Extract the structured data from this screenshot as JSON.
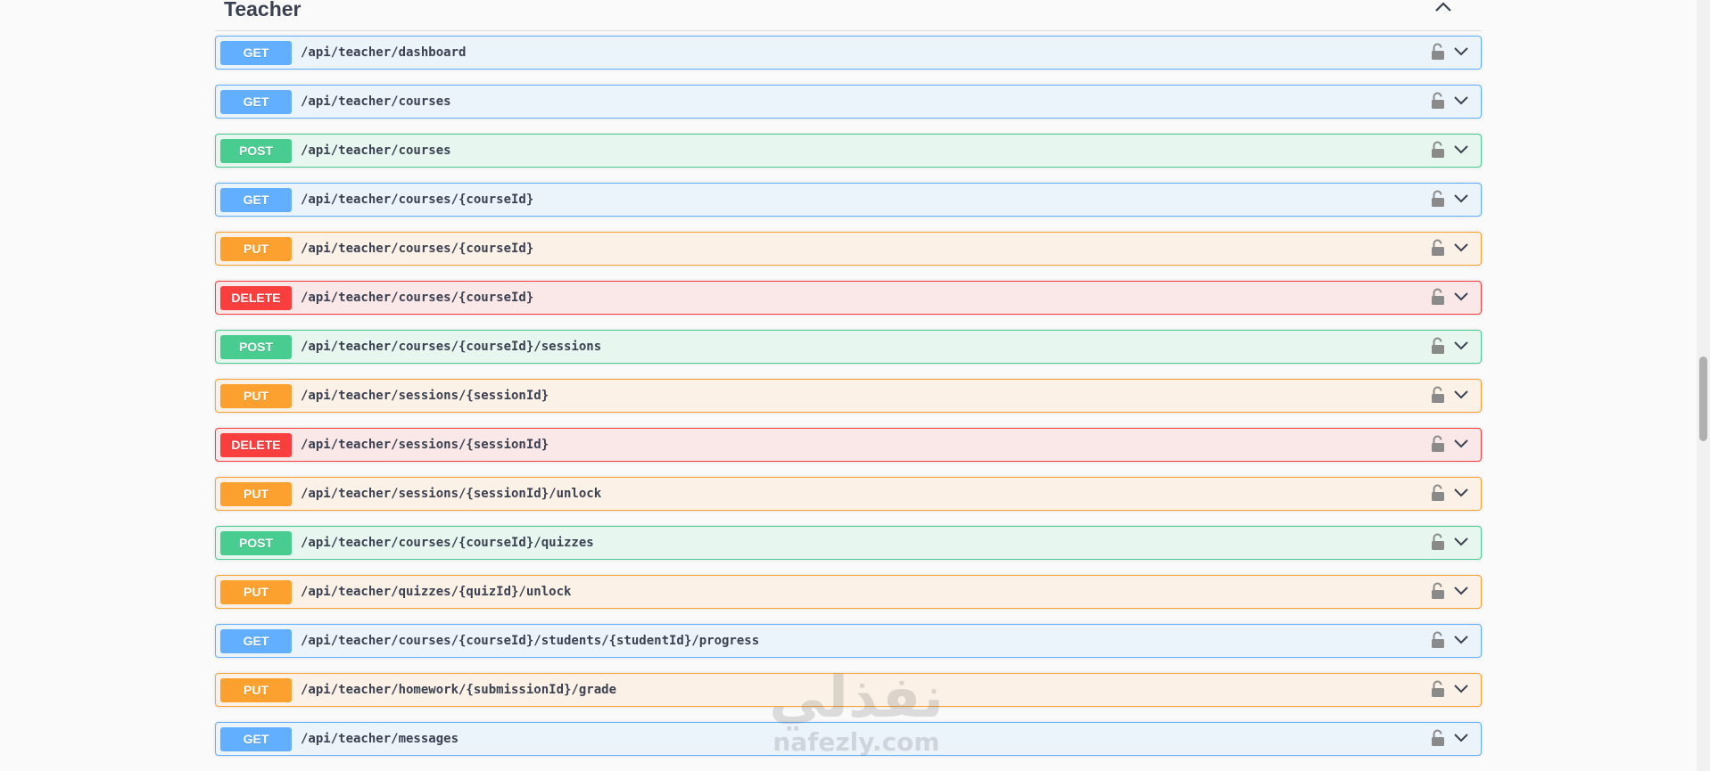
{
  "section": {
    "title": "Teacher"
  },
  "operations": [
    {
      "method": "GET",
      "path": "/api/teacher/dashboard"
    },
    {
      "method": "GET",
      "path": "/api/teacher/courses"
    },
    {
      "method": "POST",
      "path": "/api/teacher/courses"
    },
    {
      "method": "GET",
      "path": "/api/teacher/courses/{courseId}"
    },
    {
      "method": "PUT",
      "path": "/api/teacher/courses/{courseId}"
    },
    {
      "method": "DELETE",
      "path": "/api/teacher/courses/{courseId}"
    },
    {
      "method": "POST",
      "path": "/api/teacher/courses/{courseId}/sessions"
    },
    {
      "method": "PUT",
      "path": "/api/teacher/sessions/{sessionId}"
    },
    {
      "method": "DELETE",
      "path": "/api/teacher/sessions/{sessionId}"
    },
    {
      "method": "PUT",
      "path": "/api/teacher/sessions/{sessionId}/unlock"
    },
    {
      "method": "POST",
      "path": "/api/teacher/courses/{courseId}/quizzes"
    },
    {
      "method": "PUT",
      "path": "/api/teacher/quizzes/{quizId}/unlock"
    },
    {
      "method": "GET",
      "path": "/api/teacher/courses/{courseId}/students/{studentId}/progress"
    },
    {
      "method": "PUT",
      "path": "/api/teacher/homework/{submissionId}/grade"
    },
    {
      "method": "GET",
      "path": "/api/teacher/messages"
    }
  ],
  "icons": {
    "lock": "lock-icon",
    "expand": "chevron-down-icon",
    "collapse": "chevron-up-icon"
  },
  "colors": {
    "get": "#61affe",
    "post": "#49cc90",
    "put": "#fca130",
    "delete": "#f93e3e"
  },
  "watermark": {
    "arabic": "نفذلي",
    "latin": "nafezly.com"
  }
}
